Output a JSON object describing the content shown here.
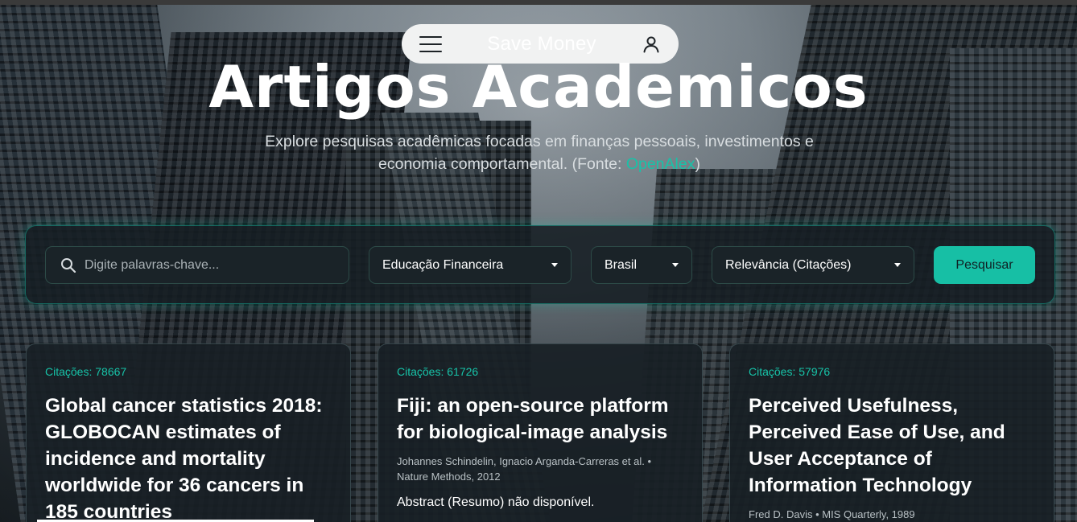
{
  "nav": {
    "brand": "Save Money"
  },
  "hero": {
    "title": "Artigos Academicos",
    "subtitle_line1": "Explore pesquisas acadêmicas focadas em finanças pessoais, investimentos e",
    "subtitle_line2_prefix": "economia comportamental. (Fonte: ",
    "subtitle_link": "OpenAlex",
    "subtitle_line2_suffix": ")"
  },
  "filters": {
    "search_placeholder": "Digite palavras-chave...",
    "category": "Educação Financeira",
    "country": "Brasil",
    "sort": "Relevância (Citações)",
    "submit_label": "Pesquisar"
  },
  "articles": [
    {
      "citations": "Citações: 78667",
      "title": "Global cancer statistics 2018: GLOBOCAN estimates of incidence and mortality worldwide for 36 cancers in 185 countries",
      "meta": "",
      "abstract": ""
    },
    {
      "citations": "Citações: 61726",
      "title": "Fiji: an open-source platform for biological-image analysis",
      "meta": "Johannes Schindelin, Ignacio Arganda-Carreras et al. • Nature Methods, 2012",
      "abstract": "Abstract (Resumo) não disponível."
    },
    {
      "citations": "Citações: 57976",
      "title": "Perceived Usefulness, Perceived Ease of Use, and User Acceptance of Information Technology",
      "meta": "Fred D. Davis • MIS Quarterly, 1989",
      "abstract": ""
    }
  ],
  "icons": {
    "menu": "menu-icon",
    "user": "user-icon",
    "search": "search-icon",
    "dropdown": "chevron-down-icon"
  },
  "colors": {
    "accent": "#17c3a8",
    "button": "#17bfa5",
    "card_bg": "#182025"
  }
}
